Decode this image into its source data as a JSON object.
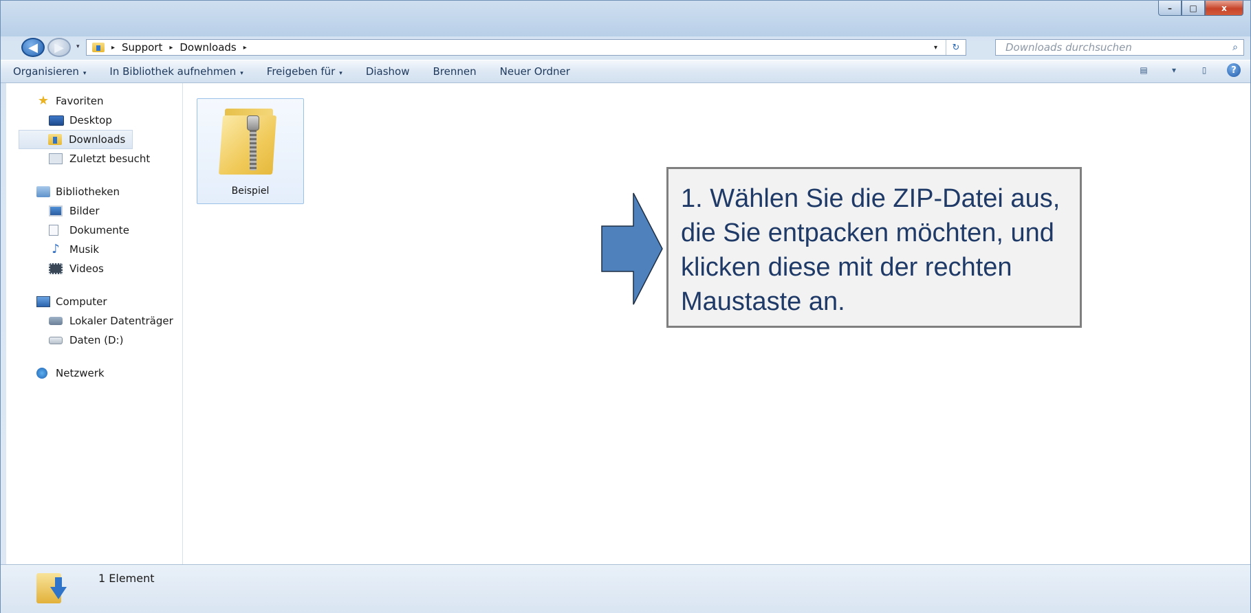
{
  "window": {
    "controls": [
      "minimize",
      "maximize",
      "close"
    ],
    "control_glyphs": {
      "minimize": "–",
      "maximize": "□",
      "close": "x"
    }
  },
  "navigation": {
    "back_glyph": "◀",
    "forward_glyph": "▶",
    "breadcrumbs": [
      "Support",
      "Downloads"
    ],
    "separator": "▸",
    "refresh_glyph": "↻",
    "dropdown_glyph": "▾"
  },
  "search": {
    "placeholder": "Downloads durchsuchen",
    "icon": "search-icon",
    "icon_glyph": "⌕"
  },
  "toolbar": {
    "items": [
      {
        "label": "Organisieren",
        "has_dropdown": true
      },
      {
        "label": "In Bibliothek aufnehmen",
        "has_dropdown": true
      },
      {
        "label": "Freigeben für",
        "has_dropdown": true
      },
      {
        "label": "Diashow",
        "has_dropdown": false
      },
      {
        "label": "Brennen",
        "has_dropdown": false
      },
      {
        "label": "Neuer Ordner",
        "has_dropdown": false
      }
    ],
    "dropdown_glyph": "▾",
    "view_glyph": "▤",
    "view_drop_glyph": "▾",
    "pane_glyph": "▯",
    "help_glyph": "?"
  },
  "sidebar": {
    "favorites": {
      "label": "Favoriten",
      "items": [
        "Desktop",
        "Downloads",
        "Zuletzt besucht"
      ],
      "selected": "Downloads"
    },
    "libraries": {
      "label": "Bibliotheken",
      "items": [
        "Bilder",
        "Dokumente",
        "Musik",
        "Videos"
      ]
    },
    "computer": {
      "label": "Computer",
      "items": [
        "Lokaler Datenträger",
        "Daten (D:)"
      ]
    },
    "network": {
      "label": "Netzwerk"
    },
    "glyphs": {
      "star": "★",
      "music": "♪"
    }
  },
  "files": [
    {
      "name": "Beispiel",
      "type": "zip-folder"
    }
  ],
  "callout": {
    "text": "1. Wählen Sie die ZIP-Datei aus, die Sie entpacken möchten, und klicken diese mit der rechten Maustaste an.",
    "text_color": "#1f3a66",
    "arrow_color": "#4f81bd"
  },
  "status": {
    "count_text": "1 Element"
  }
}
